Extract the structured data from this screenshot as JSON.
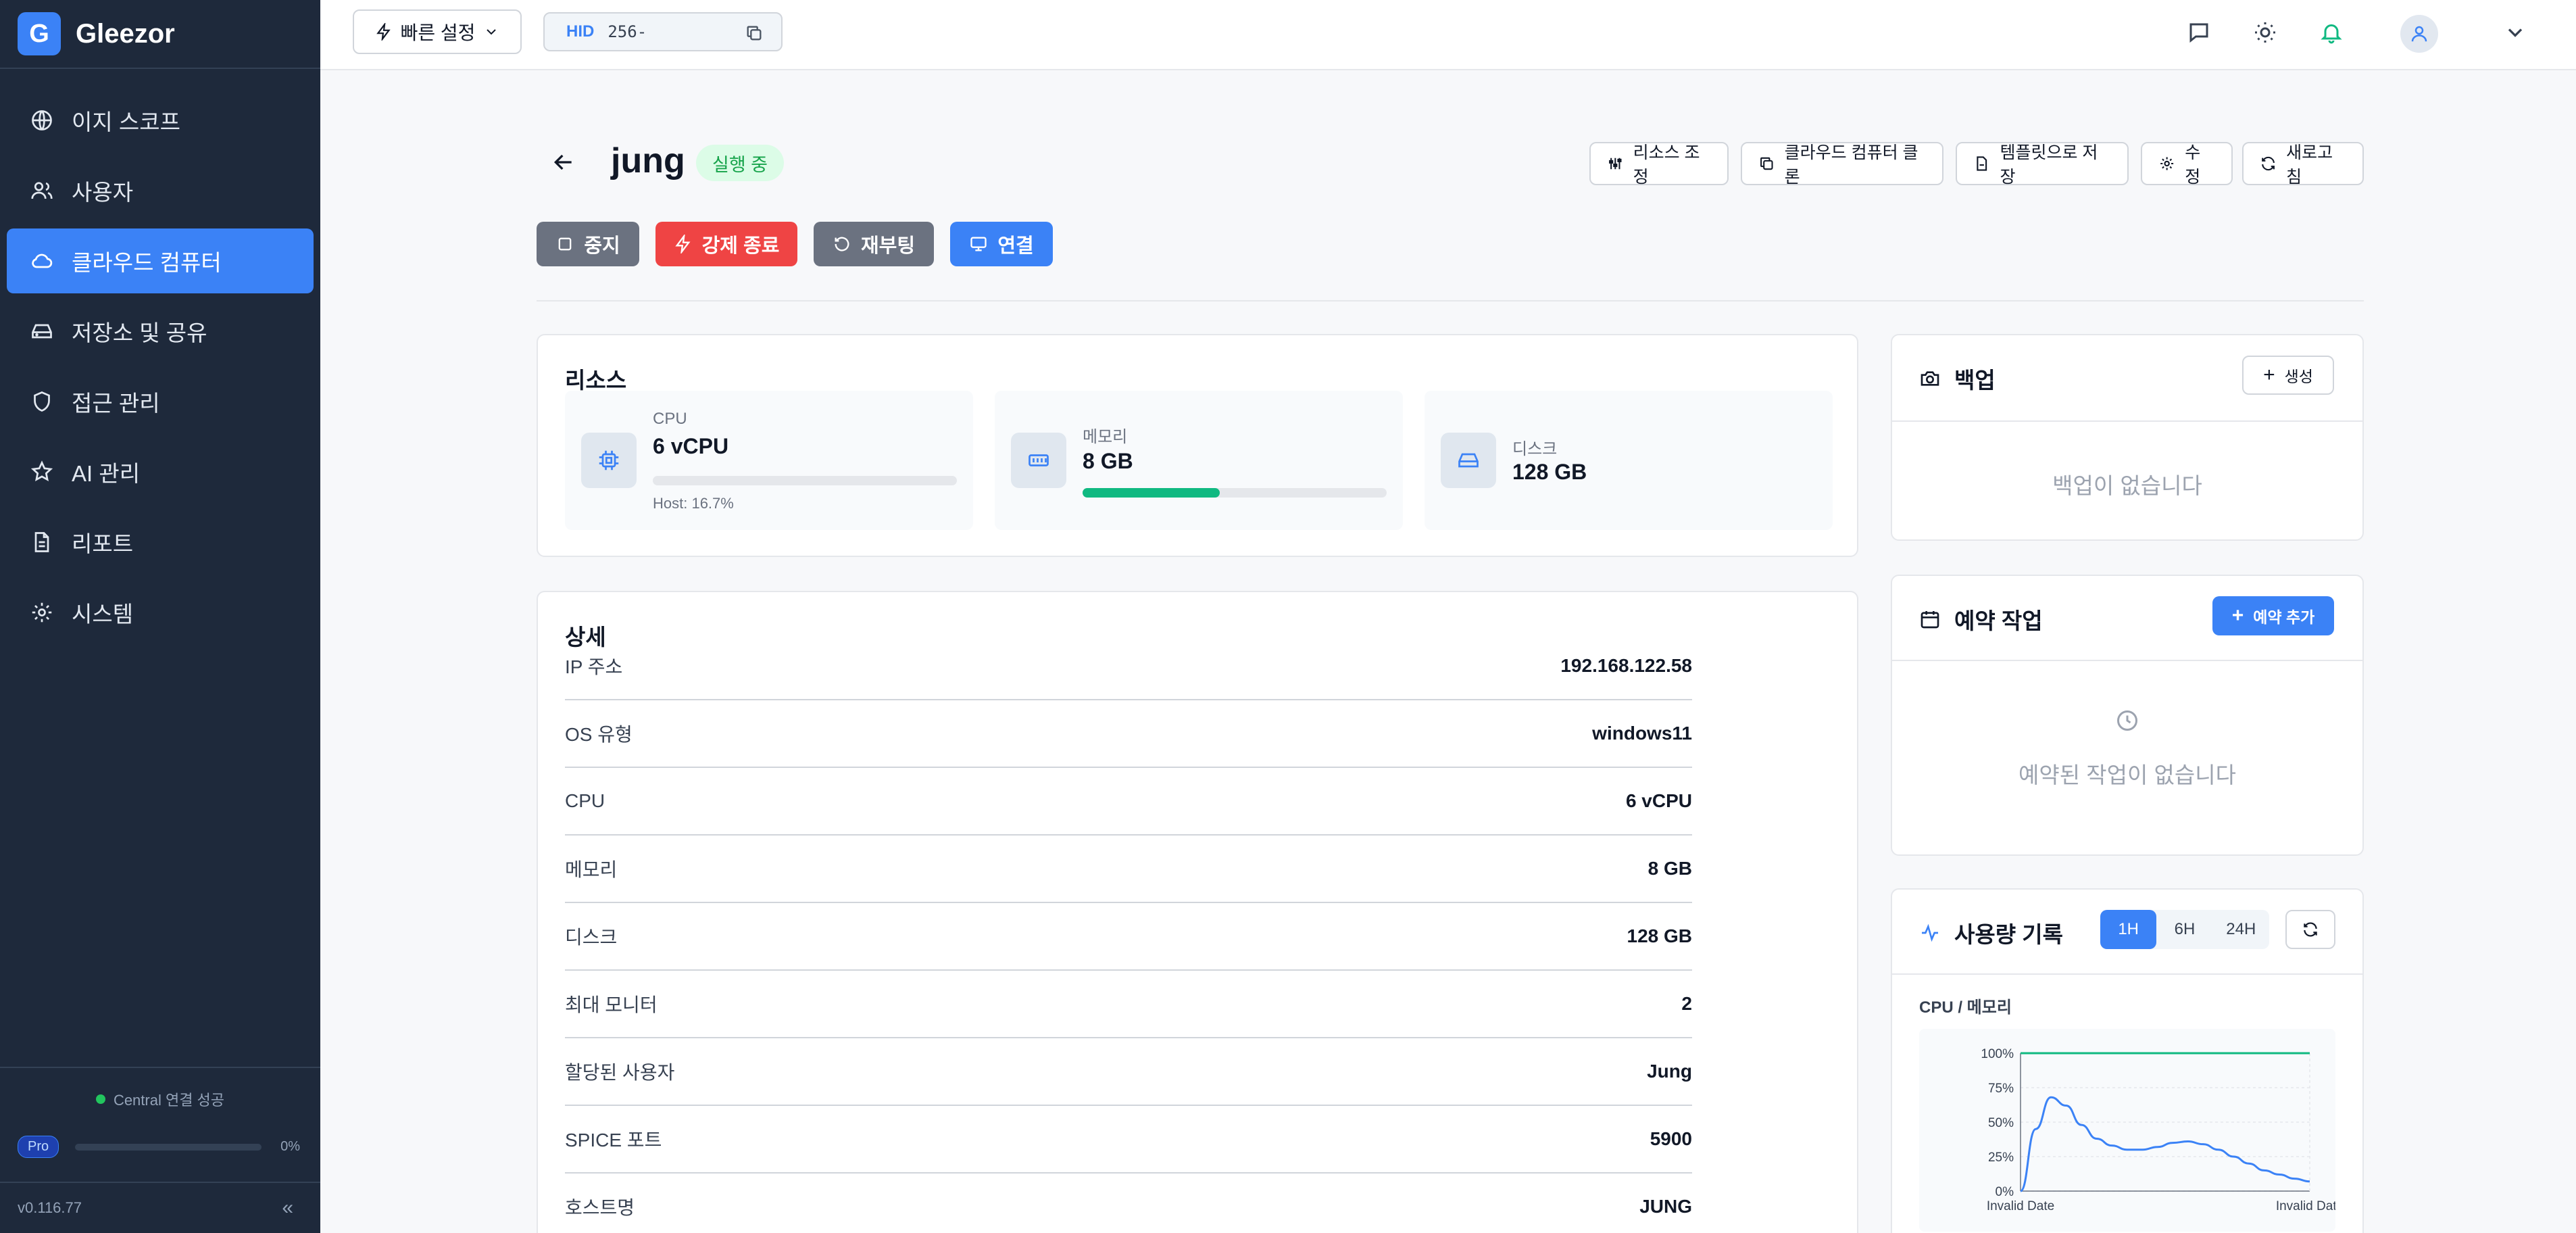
{
  "brand": {
    "logo_letter": "G",
    "name": "Gleezor"
  },
  "sidebar": {
    "items": [
      {
        "label": "이지 스코프",
        "icon": "globe-icon"
      },
      {
        "label": "사용자",
        "icon": "users-icon"
      },
      {
        "label": "클라우드 컴퓨터",
        "icon": "cloud-icon",
        "active": true
      },
      {
        "label": "저장소 및 공유",
        "icon": "drive-icon"
      },
      {
        "label": "접근 관리",
        "icon": "shield-icon"
      },
      {
        "label": "AI 관리",
        "icon": "sparkle-icon"
      },
      {
        "label": "리포트",
        "icon": "document-icon"
      },
      {
        "label": "시스템",
        "icon": "gear-icon"
      }
    ],
    "connection_status": "Central 연결 성공",
    "plan_badge": "Pro",
    "plan_usage": "0%",
    "version": "v0.116.77",
    "collapse_glyph": "«"
  },
  "topbar": {
    "quick_settings_label": "빠른 설정",
    "hid_label": "HID",
    "hid_value": "256-"
  },
  "vm": {
    "name": "jung",
    "status": "실행 중"
  },
  "toolbar": {
    "resize": "리소스 조정",
    "clone": "클라우드 컴퓨터 클론",
    "save_template": "템플릿으로 저장",
    "edit": "수정",
    "refresh": "새로고침"
  },
  "actions": {
    "stop": "중지",
    "force_stop": "강제 종료",
    "reboot": "재부팅",
    "connect": "연결"
  },
  "resources": {
    "title": "리소스",
    "cpu": {
      "label": "CPU",
      "value": "6 vCPU",
      "host": "Host: 16.7%",
      "usage": 0
    },
    "memory": {
      "label": "메모리",
      "value": "8 GB",
      "usage": 0.45
    },
    "disk": {
      "label": "디스크",
      "value": "128 GB"
    }
  },
  "details": {
    "title": "상세",
    "rows": [
      {
        "key": "IP 주소",
        "value": "192.168.122.58"
      },
      {
        "key": "OS 유형",
        "value": "windows11"
      },
      {
        "key": "CPU",
        "value": "6 vCPU"
      },
      {
        "key": "메모리",
        "value": "8 GB"
      },
      {
        "key": "디스크",
        "value": "128 GB"
      },
      {
        "key": "최대 모니터",
        "value": "2"
      },
      {
        "key": "할당된 사용자",
        "value": "Jung"
      },
      {
        "key": "SPICE 포트",
        "value": "5900"
      },
      {
        "key": "호스트명",
        "value": "JUNG"
      }
    ]
  },
  "backup": {
    "title": "백업",
    "create_label": "생성",
    "empty_text": "백업이 없습니다"
  },
  "schedule": {
    "title": "예약 작업",
    "add_label": "예약 추가",
    "empty_text": "예약된 작업이 없습니다"
  },
  "usage": {
    "title": "사용량 기록",
    "ranges": [
      "1H",
      "6H",
      "24H"
    ],
    "selected_range": "1H",
    "chart_title": "CPU / 메모리"
  },
  "colors": {
    "accent": "#3b82f6",
    "danger": "#ef4444",
    "neutral_button": "#6b7280",
    "success": "#10b981",
    "sidebar_bg": "#1e293b"
  },
  "chart_data": {
    "type": "line",
    "title": "CPU / 메모리",
    "x": [
      "Invalid Date",
      "",
      "",
      "",
      "",
      "",
      "",
      "",
      "",
      "",
      "",
      "",
      "",
      "",
      "",
      "",
      "",
      "",
      "",
      "Invalid Date"
    ],
    "y_ticks": [
      "0%",
      "25%",
      "50%",
      "75%",
      "100%"
    ],
    "ylim": [
      0,
      100
    ],
    "series": [
      {
        "color": "#10b981",
        "values": [
          100,
          100,
          100,
          100,
          100,
          100,
          100,
          100,
          100,
          100,
          100,
          100,
          100,
          100,
          100,
          100,
          100,
          100,
          100,
          100
        ]
      },
      {
        "color": "#3b82f6",
        "values": [
          0,
          45,
          68,
          62,
          48,
          38,
          33,
          30,
          30,
          32,
          35,
          36,
          34,
          30,
          25,
          20,
          15,
          12,
          9,
          7
        ]
      }
    ],
    "grid": true
  }
}
